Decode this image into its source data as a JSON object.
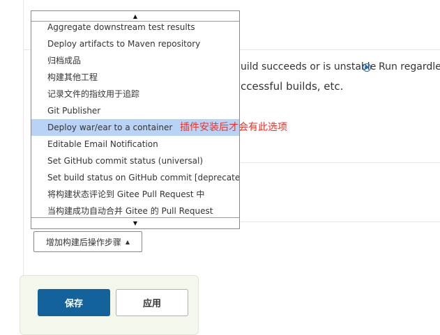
{
  "background": {
    "row1_text": "uild succeeds or is unstable",
    "radio_label": "Run regardless",
    "row2_text": "ccessful builds, etc."
  },
  "dropdown": {
    "items": [
      {
        "label": "Aggregate downstream test results"
      },
      {
        "label": "Deploy artifacts to Maven repository"
      },
      {
        "label": "归档成品"
      },
      {
        "label": "构建其他工程"
      },
      {
        "label": "记录文件的指纹用于追踪"
      },
      {
        "label": "Git Publisher"
      },
      {
        "label": "Deploy war/ear to a container",
        "selected": true
      },
      {
        "label": "Editable Email Notification"
      },
      {
        "label": "Set GitHub commit status (universal)"
      },
      {
        "label": "Set build status on GitHub commit [deprecated]"
      },
      {
        "label": "将构建状态评论到 Gitee Pull Request 中"
      },
      {
        "label": "当构建成功自动合并 Gitee 的 Pull Request"
      }
    ]
  },
  "annotation": "插件安装后才会有此选项",
  "add_step_button": "增加构建后操作步骤",
  "actions": {
    "save": "保存",
    "apply": "应用"
  },
  "colors": {
    "selected_item": "#b8d3f5",
    "annotation": "#e8342b",
    "save_button": "#13629b",
    "panel": "#f3f7ec"
  }
}
